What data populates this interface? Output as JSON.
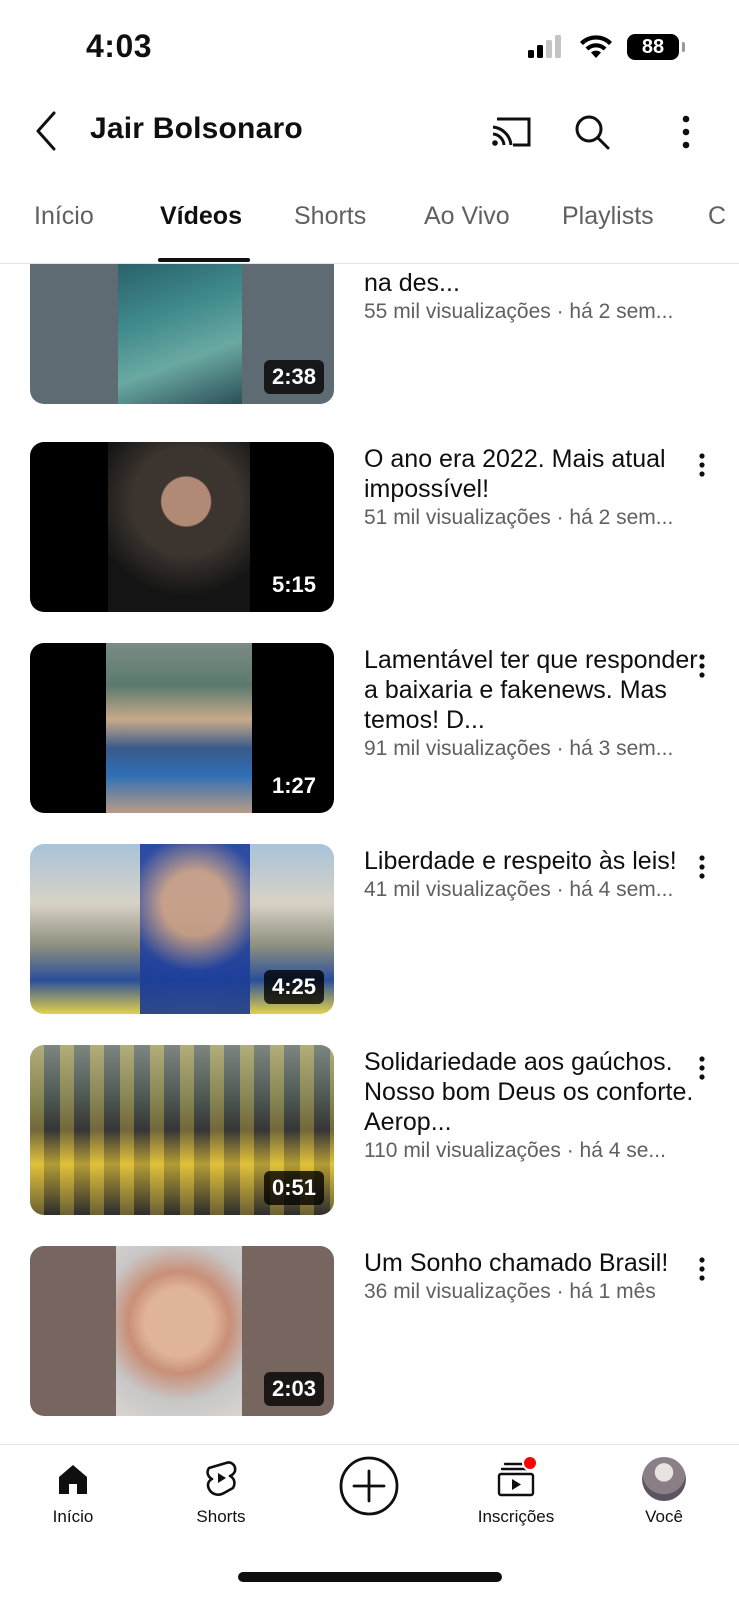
{
  "status_bar": {
    "time": "4:03",
    "battery": "88"
  },
  "header": {
    "channel_name": "Jair Bolsonaro"
  },
  "tabs": [
    {
      "label": "Início"
    },
    {
      "label": "Vídeos"
    },
    {
      "label": "Shorts"
    },
    {
      "label": "Ao Vivo"
    },
    {
      "label": "Playlists"
    },
    {
      "label": "C"
    }
  ],
  "videos": [
    {
      "title": "Carlos e Eduardo Bolsonaro no Rio Grande do Sul. Detalhes na des...",
      "stats": "55 mil visualizações · há 2 sem...",
      "duration": "2:38"
    },
    {
      "title": "O ano era 2022. Mais atual impossível!",
      "stats": "51 mil visualizações · há 2 sem...",
      "duration": "5:15"
    },
    {
      "title": "Lamentável ter que responder a baixaria e fakenews. Mas temos! D...",
      "stats": "91 mil visualizações · há 3 sem...",
      "duration": "1:27"
    },
    {
      "title": "Liberdade e respeito às leis!",
      "stats": "41 mil visualizações · há 4 sem...",
      "duration": "4:25"
    },
    {
      "title": "Solidariedade aos gaúchos. Nosso bom Deus os conforte. Aerop...",
      "stats": "110 mil visualizações · há 4 se...",
      "duration": "0:51"
    },
    {
      "title": "Um Sonho chamado Brasil!",
      "stats": "36 mil visualizações · há 1 mês",
      "duration": "2:03"
    }
  ],
  "bottom_nav": [
    {
      "label": "Início"
    },
    {
      "label": "Shorts"
    },
    {
      "label": ""
    },
    {
      "label": "Inscrições"
    },
    {
      "label": "Você"
    }
  ]
}
